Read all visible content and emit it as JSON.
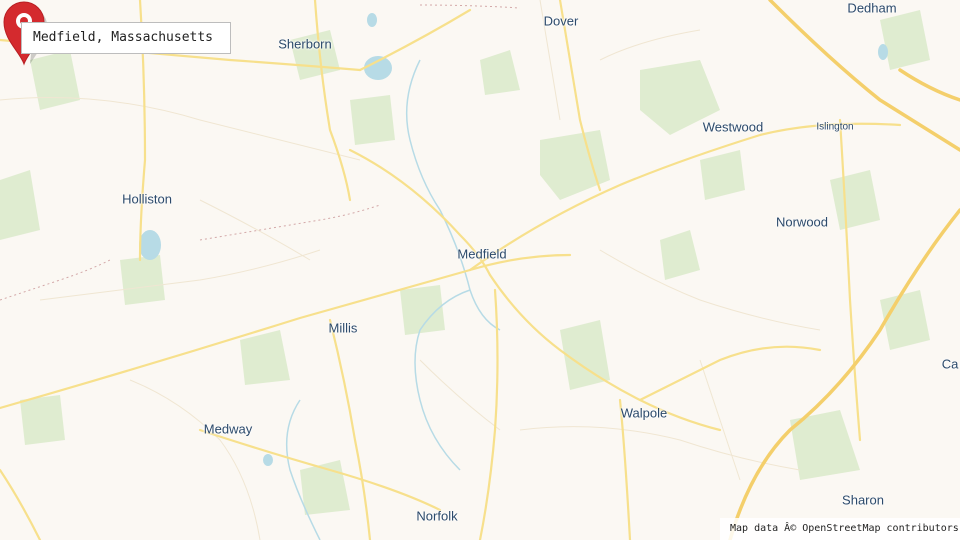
{
  "title": "Medfield, Massachusetts",
  "attribution": "Map data Â© OpenStreetMap contributors",
  "places": {
    "sherborn": "Sherborn",
    "dover": "Dover",
    "dedham": "Dedham",
    "westwood": "Westwood",
    "islington": "Islington",
    "holliston": "Holliston",
    "norwood": "Norwood",
    "medfield": "Medfield",
    "millis": "Millis",
    "walpole": "Walpole",
    "medway": "Medway",
    "norfolk": "Norfolk",
    "sharon": "Sharon",
    "canton": "Ca"
  },
  "marker": {
    "icon": "map-pin-icon",
    "color": "#d42a2e"
  },
  "colors": {
    "land": "#fbf8f3",
    "green": "#d9e8c6",
    "water": "#b7dbe6",
    "road": "#f7e08c"
  }
}
